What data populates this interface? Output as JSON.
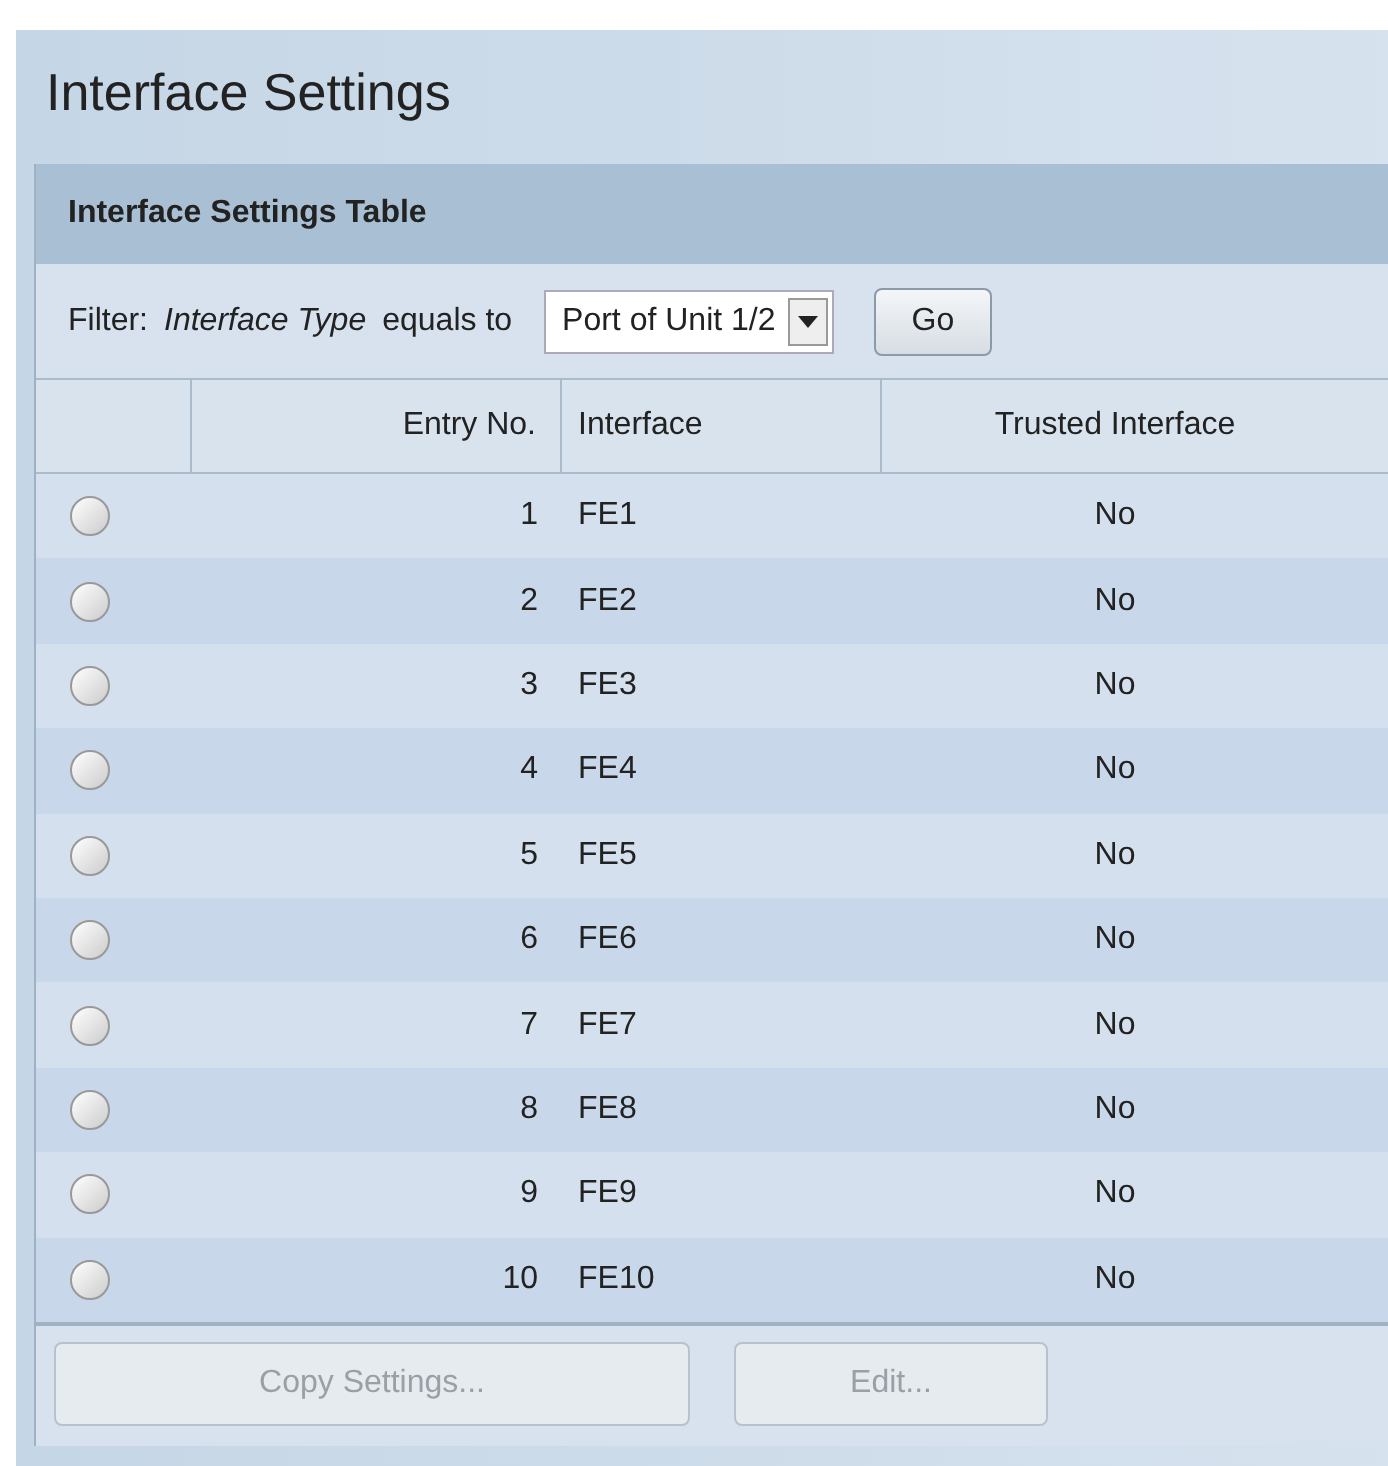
{
  "title": "Interface Settings",
  "table": {
    "title": "Interface Settings Table",
    "filter": {
      "label": "Filter:",
      "field": "Interface Type",
      "operator": "equals to",
      "value": "Port of Unit 1/2",
      "button": "Go"
    },
    "columns": [
      "Entry No.",
      "Interface",
      "Trusted Interface"
    ],
    "rows": [
      {
        "entry": "1",
        "interface": "FE1",
        "trusted": "No",
        "selected": false
      },
      {
        "entry": "2",
        "interface": "FE2",
        "trusted": "No",
        "selected": false
      },
      {
        "entry": "3",
        "interface": "FE3",
        "trusted": "No",
        "selected": false
      },
      {
        "entry": "4",
        "interface": "FE4",
        "trusted": "No",
        "selected": false
      },
      {
        "entry": "5",
        "interface": "FE5",
        "trusted": "No",
        "selected": false
      },
      {
        "entry": "6",
        "interface": "FE6",
        "trusted": "No",
        "selected": false
      },
      {
        "entry": "7",
        "interface": "FE7",
        "trusted": "No",
        "selected": false
      },
      {
        "entry": "8",
        "interface": "FE8",
        "trusted": "No",
        "selected": false
      },
      {
        "entry": "9",
        "interface": "FE9",
        "trusted": "No",
        "selected": false
      },
      {
        "entry": "10",
        "interface": "FE10",
        "trusted": "No",
        "selected": false
      }
    ]
  },
  "buttons": [
    {
      "label": "Copy Settings...",
      "disabled": true
    },
    {
      "label": "Edit...",
      "disabled": true
    }
  ]
}
